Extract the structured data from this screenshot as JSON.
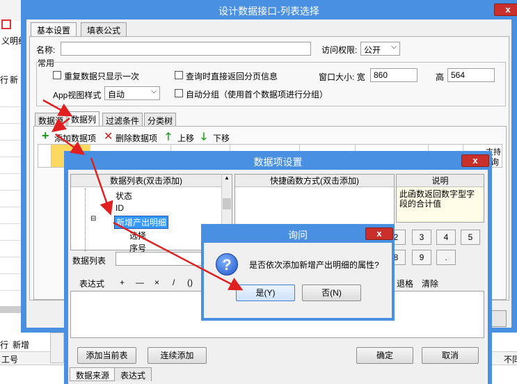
{
  "background_app": {
    "labels": [
      "义明纪",
      "行",
      "新",
      "行",
      "新增",
      "工号",
      "不同"
    ]
  },
  "main_window": {
    "title": "设计数据接口-列表选择",
    "close": "x",
    "tabs": [
      "基本设置",
      "填表公式"
    ],
    "name_label": "名称:",
    "name_value": "",
    "access_label": "访问权限:",
    "access_value": "公开",
    "common_label": "常用",
    "cb_repeat": "重复数据只显示一次",
    "cb_query_page": "查询时直接返回分页信息",
    "window_size_label": "窗口大小: 宽",
    "width_value": "860",
    "height_label": "高",
    "height_value": "564",
    "app_view_label": "App视图样式",
    "app_view_value": "自动",
    "cb_auto_group": "自动分组（使用首个数据项进行分组）",
    "sub_tabs": [
      "数据源",
      "数据列",
      "过滤条件",
      "分类树"
    ],
    "toolbar": {
      "add": "添加数据项",
      "delete": "删除数据项",
      "up": "上移",
      "down": "下移"
    },
    "grid_header_right": [
      "支持",
      "询"
    ]
  },
  "data_item_dialog": {
    "title": "数据项设置",
    "close": "x",
    "list_header": "数据列表(双击添加)",
    "tree_items": [
      "状态",
      "ID",
      "新增产出明细",
      "选择",
      "序号"
    ],
    "func_header": "快捷函数方式(双击添加)",
    "desc_header": "说明",
    "desc_text": "此函数返回数字型字段的合计值",
    "data_list_label": "数据列表",
    "keypad": [
      "2",
      "3",
      "4",
      "5",
      "8",
      "9",
      "."
    ],
    "expr_label": "表达式",
    "operators": [
      "+",
      "—",
      "×",
      "/",
      "()"
    ],
    "backspace": "退格",
    "clear": "清除",
    "btn_add_table": "添加当前表",
    "btn_continue": "连续添加",
    "btn_ok": "确定",
    "btn_cancel": "取消",
    "bottom_tabs": [
      "数据来源",
      "表达式"
    ]
  },
  "confirm_dialog": {
    "title": "询问",
    "close": "x",
    "message": "是否依次添加新增产出明细的属性?",
    "yes": "是(Y)",
    "no": "否(N)"
  },
  "colors": {
    "frame_blue": "#4a90e2",
    "close_red": "#c9302c",
    "selected": "#3399ff",
    "arrow": "#e02020"
  }
}
